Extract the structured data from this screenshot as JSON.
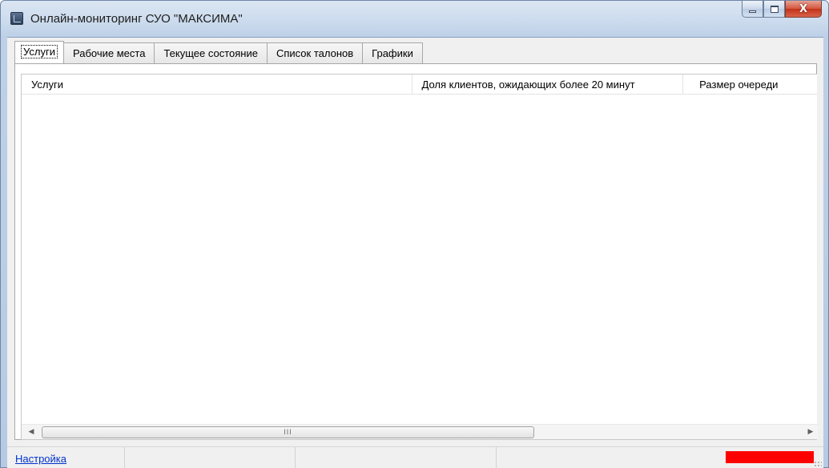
{
  "window": {
    "title": "Онлайн-мониторинг СУО \"МАКСИМА\"",
    "icon": "monitor-app-icon",
    "controls": [
      "minimize-icon",
      "maximize-icon",
      "close-icon"
    ],
    "close_glyph": "X"
  },
  "tabs": [
    {
      "label": "Услуги",
      "active": true
    },
    {
      "label": "Рабочие места",
      "active": false
    },
    {
      "label": "Текущее состояние",
      "active": false
    },
    {
      "label": "Список талонов",
      "active": false
    },
    {
      "label": "Графики",
      "active": false
    }
  ],
  "table": {
    "columns": [
      "Услуги",
      "Доля клиентов, ожидающих более 20 минут",
      "Размер очереди"
    ],
    "rows": []
  },
  "scrollbar": {
    "left_arrow": "◀",
    "right_arrow": "▶",
    "thumb_grip": "III"
  },
  "statusbar": {
    "settings_link": "Настройка",
    "indicator_color": "#ff0000"
  }
}
